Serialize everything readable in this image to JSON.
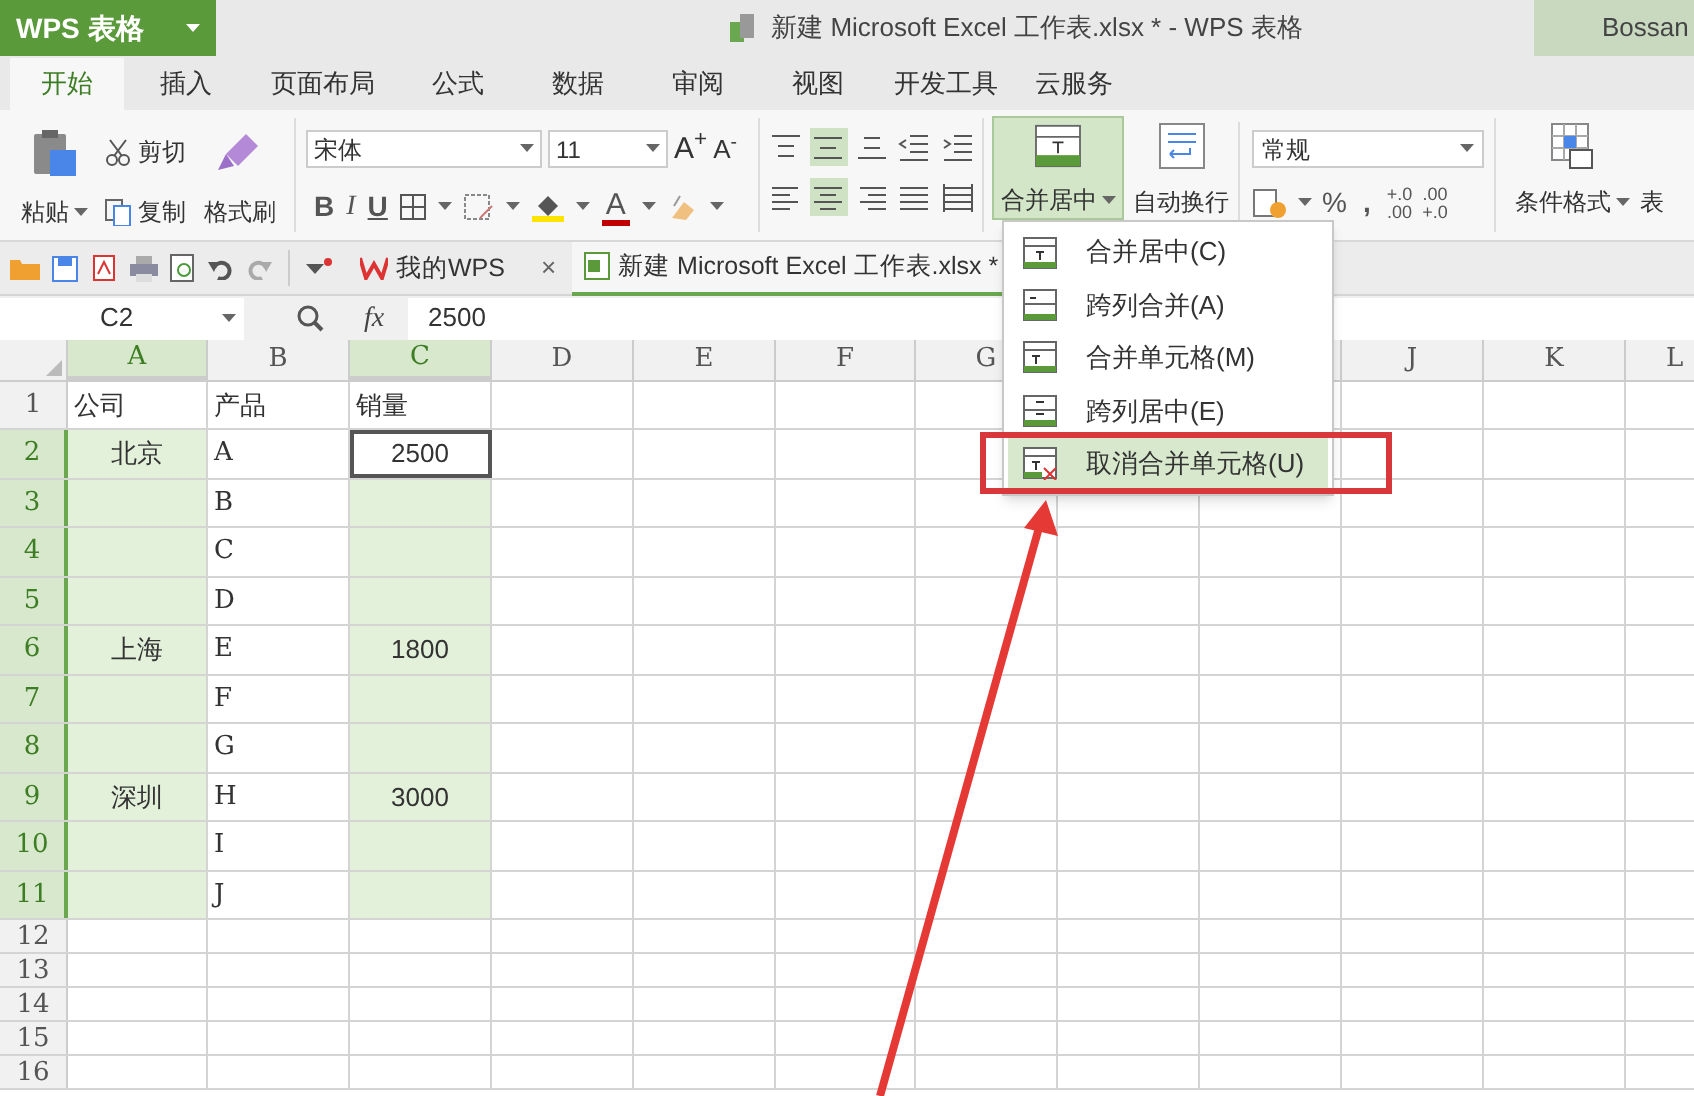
{
  "app_button": {
    "label": "WPS 表格"
  },
  "window": {
    "title": "新建 Microsoft Excel 工作表.xlsx * - WPS 表格",
    "account": "Bossan"
  },
  "ribbon_tabs": [
    {
      "label": "开始",
      "selected": true
    },
    {
      "label": "插入",
      "selected": false
    },
    {
      "label": "页面布局",
      "selected": false
    },
    {
      "label": "公式",
      "selected": false
    },
    {
      "label": "数据",
      "selected": false
    },
    {
      "label": "审阅",
      "selected": false
    },
    {
      "label": "视图",
      "selected": false
    },
    {
      "label": "开发工具",
      "selected": false
    },
    {
      "label": "云服务",
      "selected": false
    }
  ],
  "clipboard": {
    "paste": "粘贴",
    "cut": "剪切",
    "copy": "复制",
    "format_painter": "格式刷"
  },
  "font": {
    "name": "宋体",
    "size": "11",
    "grow": "A$^{+}$",
    "shrink": "A$^{-}$",
    "bold": "B",
    "italic": "I",
    "underline": "U",
    "font_color": "A"
  },
  "align_buttons": [
    {
      "kind": "top",
      "selected": false
    },
    {
      "kind": "middle",
      "selected": true
    },
    {
      "kind": "bottom",
      "selected": false
    },
    {
      "kind": "indent-less",
      "selected": false
    },
    {
      "kind": "indent-more",
      "selected": false
    },
    {
      "kind": "left",
      "selected": false
    },
    {
      "kind": "center",
      "selected": true
    },
    {
      "kind": "right",
      "selected": false
    },
    {
      "kind": "justify",
      "selected": false
    },
    {
      "kind": "distributed",
      "selected": false
    }
  ],
  "merge_button": {
    "label": "合并居中",
    "expanded": true
  },
  "wrap_button": {
    "label": "自动换行"
  },
  "number": {
    "format": "常规",
    "percent": "%",
    "comma": ",",
    "decimals": [
      {
        "top": "+.0",
        "bottom": ".00"
      },
      {
        "top": ".00",
        "bottom": "+.0"
      }
    ]
  },
  "conditional_format": {
    "label": "条件格式"
  },
  "table_style": {
    "label": "表"
  },
  "doc_tabs": [
    {
      "label": "我的WPS",
      "selected": false,
      "close": "×"
    },
    {
      "label": "新建 Microsoft Excel 工作表.xlsx *",
      "selected": true
    }
  ],
  "formula_bar": {
    "cell_ref": "C2",
    "fx": "fx",
    "value": "2500"
  },
  "sheet": {
    "columns": [
      {
        "label": "A",
        "selected": true
      },
      {
        "label": "B",
        "selected": false
      },
      {
        "label": "C",
        "selected": true
      },
      {
        "label": "D",
        "selected": false
      },
      {
        "label": "E",
        "selected": false
      },
      {
        "label": "F",
        "selected": false
      },
      {
        "label": "G",
        "selected": false
      },
      {
        "label": "J",
        "selected": false
      },
      {
        "label": "K",
        "selected": false
      },
      {
        "label": "L",
        "selected": false
      }
    ],
    "rows": [
      {
        "label": "1",
        "selected": false,
        "cells": [
          {
            "text": "公司",
            "active": false
          },
          {
            "text": "产品",
            "active": false
          },
          {
            "text": "销量",
            "active": false
          }
        ]
      },
      {
        "label": "2",
        "selected": true,
        "cells": [
          {
            "text": "北京",
            "active": false
          },
          {
            "text": "A",
            "active": false
          },
          {
            "text": "2500",
            "active": true
          }
        ]
      },
      {
        "label": "3",
        "selected": true,
        "cells": [
          {
            "active": false
          },
          {
            "text": "B",
            "active": false
          },
          {
            "active": false
          }
        ]
      },
      {
        "label": "4",
        "selected": true,
        "cells": [
          {
            "active": false
          },
          {
            "text": "C",
            "active": false
          },
          {
            "active": false
          }
        ]
      },
      {
        "label": "5",
        "selected": true,
        "cells": [
          {
            "active": false
          },
          {
            "text": "D",
            "active": false
          },
          {
            "active": false
          }
        ]
      },
      {
        "label": "6",
        "selected": true,
        "cells": [
          {
            "text": "上海",
            "active": false
          },
          {
            "text": "E",
            "active": false
          },
          {
            "text": "1800",
            "active": false
          }
        ]
      },
      {
        "label": "7",
        "selected": true,
        "cells": [
          {
            "active": false
          },
          {
            "text": "F",
            "active": false
          },
          {
            "active": false
          }
        ]
      },
      {
        "label": "8",
        "selected": true,
        "cells": [
          {
            "active": false
          },
          {
            "text": "G",
            "active": false
          },
          {
            "active": false
          }
        ]
      },
      {
        "label": "9",
        "selected": true,
        "cells": [
          {
            "text": "深圳",
            "active": false
          },
          {
            "text": "H",
            "active": false
          },
          {
            "text": "3000",
            "active": false
          }
        ]
      },
      {
        "label": "10",
        "selected": true,
        "cells": [
          {
            "active": false
          },
          {
            "text": "I",
            "active": false
          },
          {
            "active": false
          }
        ]
      },
      {
        "label": "11",
        "selected": true,
        "cells": [
          {
            "active": false
          },
          {
            "text": "J",
            "active": false
          },
          {
            "active": false
          }
        ]
      },
      {
        "label": "12",
        "selected": false
      },
      {
        "label": "13",
        "selected": false
      },
      {
        "label": "14",
        "selected": false
      },
      {
        "label": "15",
        "selected": false
      },
      {
        "label": "16",
        "selected": false
      }
    ]
  },
  "merge_menu": {
    "items": [
      {
        "label": "合并居中(C)",
        "selected": false
      },
      {
        "label": "跨列合并(A)",
        "selected": false
      },
      {
        "label": "合并单元格(M)",
        "selected": false
      },
      {
        "label": "跨列居中(E)",
        "selected": false
      },
      {
        "label": "取消合并单元格(U)",
        "selected": true
      }
    ]
  }
}
